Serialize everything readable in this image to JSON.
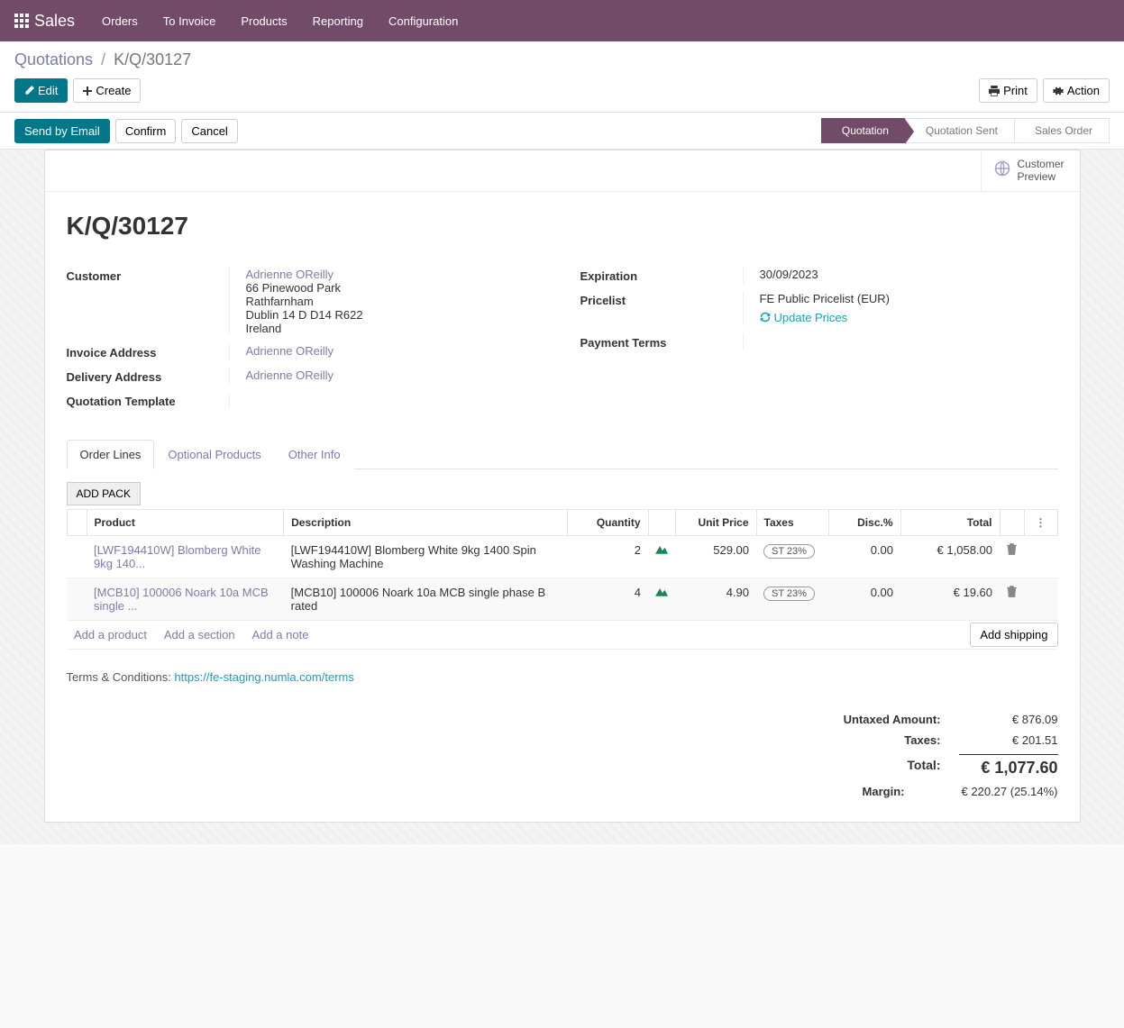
{
  "topbar": {
    "brand": "Sales",
    "nav": [
      "Orders",
      "To Invoice",
      "Products",
      "Reporting",
      "Configuration"
    ]
  },
  "breadcrumb": {
    "root": "Quotations",
    "current": "K/Q/30127"
  },
  "buttons": {
    "edit": "Edit",
    "create": "Create",
    "print": "Print",
    "action": "Action",
    "send": "Send by Email",
    "confirm": "Confirm",
    "cancel": "Cancel",
    "add_shipping": "Add shipping",
    "add_pack": "ADD PACK"
  },
  "stages": [
    "Quotation",
    "Quotation Sent",
    "Sales Order"
  ],
  "active_stage": 0,
  "stat": {
    "line1": "Customer",
    "line2": "Preview"
  },
  "doc_title": "K/Q/30127",
  "fields": {
    "customer_label": "Customer",
    "customer_name": "Adrienne OReilly",
    "customer_addr1": "66 Pinewood Park",
    "customer_addr2": "Rathfarnham",
    "customer_addr3": "Dublin 14 D D14 R622",
    "customer_addr4": "Ireland",
    "invoice_label": "Invoice Address",
    "invoice_value": "Adrienne OReilly",
    "delivery_label": "Delivery Address",
    "delivery_value": "Adrienne OReilly",
    "template_label": "Quotation Template",
    "expiration_label": "Expiration",
    "expiration_value": "30/09/2023",
    "pricelist_label": "Pricelist",
    "pricelist_value": "FE Public Pricelist (EUR)",
    "update_prices": "Update Prices",
    "payment_terms_label": "Payment Terms"
  },
  "tabs": [
    "Order Lines",
    "Optional Products",
    "Other Info"
  ],
  "active_tab": 0,
  "table": {
    "headers": {
      "product": "Product",
      "description": "Description",
      "quantity": "Quantity",
      "unit_price": "Unit Price",
      "taxes": "Taxes",
      "disc": "Disc.%",
      "total": "Total"
    },
    "rows": [
      {
        "product": "[LWF194410W] Blomberg White 9kg 140...",
        "description": "[LWF194410W] Blomberg White 9kg 1400 Spin Washing Machine",
        "quantity": "2",
        "unit_price": "529.00",
        "tax": "ST 23%",
        "disc": "0.00",
        "total": "€ 1,058.00"
      },
      {
        "product": "[MCB10] 100006 Noark 10a MCB single ...",
        "description": "[MCB10] 100006 Noark 10a MCB single phase B rated",
        "quantity": "4",
        "unit_price": "4.90",
        "tax": "ST 23%",
        "disc": "0.00",
        "total": "€ 19.60"
      }
    ],
    "add_product": "Add a product",
    "add_section": "Add a section",
    "add_note": "Add a note"
  },
  "terms": {
    "label": "Terms & Conditions: ",
    "url": "https://fe-staging.numla.com/terms"
  },
  "totals": {
    "untaxed_label": "Untaxed Amount:",
    "untaxed": "€ 876.09",
    "taxes_label": "Taxes:",
    "taxes": "€ 201.51",
    "total_label": "Total:",
    "total": "€ 1,077.60",
    "margin_label": "Margin:",
    "margin": "€ 220.27 (25.14%)"
  }
}
